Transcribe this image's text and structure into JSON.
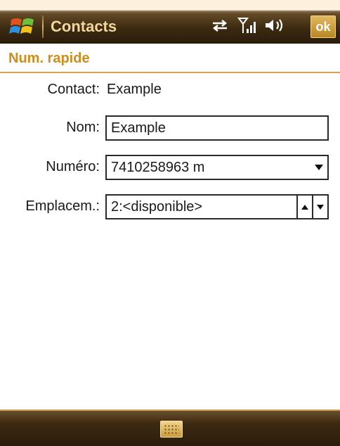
{
  "title_bar": {
    "app_title": "Contacts",
    "ok_label": "ok",
    "icons": [
      "windows-start-icon",
      "sync-icon",
      "signal-icon",
      "volume-icon"
    ]
  },
  "header": {
    "title": "Num. rapide"
  },
  "form": {
    "contact": {
      "label": "Contact:",
      "value": "Example"
    },
    "name": {
      "label": "Nom:",
      "value": "Example"
    },
    "number": {
      "label": "Numéro:",
      "value": "7410258963 m"
    },
    "location": {
      "label": "Emplacem.:",
      "value": "2:<disponible>"
    }
  },
  "bottom_bar": {
    "icons": [
      "keyboard-icon"
    ]
  },
  "colors": {
    "accent": "#d08c1c",
    "bar_dark": "#2a1c0a",
    "title_text": "#f3d79a"
  }
}
